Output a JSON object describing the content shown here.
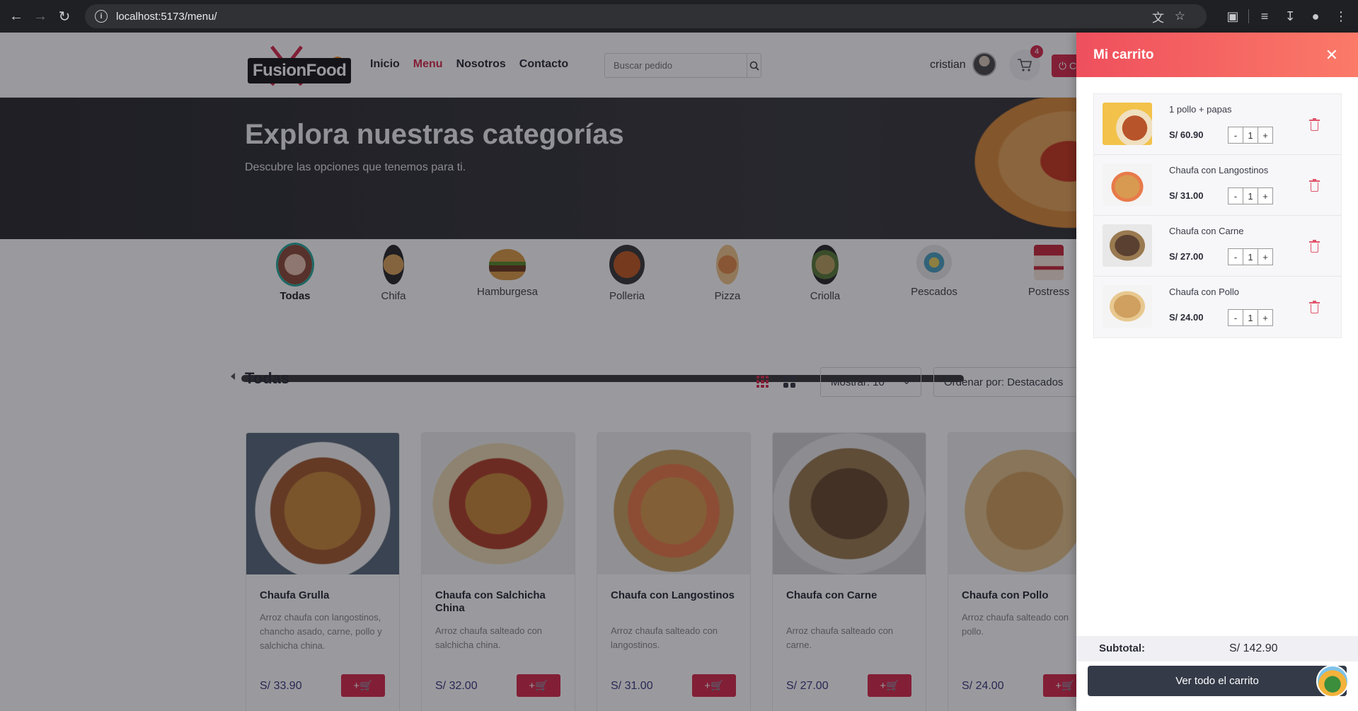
{
  "browser": {
    "url": "localhost:5173/menu/"
  },
  "header": {
    "logo_text": "FusionFood",
    "nav": [
      {
        "label": "Inicio",
        "active": false
      },
      {
        "label": "Menu",
        "active": true
      },
      {
        "label": "Nosotros",
        "active": false
      },
      {
        "label": "Contacto",
        "active": false
      }
    ],
    "search_placeholder": "Buscar pedido",
    "user_name": "cristian",
    "cart_count": "4",
    "logout_label": "C"
  },
  "hero": {
    "title": "Explora nuestras categorías",
    "subtitle": "Descubre las opciones que tenemos para ti."
  },
  "categories": [
    {
      "label": "Todas",
      "active": true
    },
    {
      "label": "Chifa",
      "active": false
    },
    {
      "label": "Hamburgesa",
      "active": false
    },
    {
      "label": "Polleria",
      "active": false
    },
    {
      "label": "Pizza",
      "active": false
    },
    {
      "label": "Criolla",
      "active": false
    },
    {
      "label": "Pescados",
      "active": false
    },
    {
      "label": "Postress",
      "active": false
    }
  ],
  "listing": {
    "title": "Todas",
    "show_label": "Mostrar: 10",
    "sort_label": "Ordenar por: Destacados"
  },
  "products": [
    {
      "name": "Chaufa Grulla",
      "desc": "Arroz chaufa con langostinos, chancho asado, carne, pollo y salchicha china.",
      "price": "S/ 33.90"
    },
    {
      "name": "Chaufa con Salchicha China",
      "desc": "Arroz chaufa salteado con salchicha china.",
      "price": "S/ 32.00"
    },
    {
      "name": "Chaufa con Langostinos",
      "desc": "Arroz chaufa salteado con langostinos.",
      "price": "S/ 31.00"
    },
    {
      "name": "Chaufa con Carne",
      "desc": "Arroz chaufa salteado con carne.",
      "price": "S/ 27.00"
    },
    {
      "name": "Chaufa con Pollo",
      "desc": "Arroz chaufa salteado con pollo.",
      "price": "S/ 24.00"
    }
  ],
  "cart": {
    "title": "Mi carrito",
    "items": [
      {
        "name": "1 pollo + papas",
        "price": "S/ 60.90",
        "qty": "1"
      },
      {
        "name": "Chaufa con Langostinos",
        "price": "S/ 31.00",
        "qty": "1"
      },
      {
        "name": "Chaufa con Carne",
        "price": "S/ 27.00",
        "qty": "1"
      },
      {
        "name": "Chaufa con Pollo",
        "price": "S/ 24.00",
        "qty": "1"
      }
    ],
    "subtotal_label": "Subtotal:",
    "subtotal_value": "S/ 142.90",
    "view_cart_label": "Ver todo el carrito"
  },
  "colors": {
    "accent": "#d62b4d",
    "drawer_header": "#f25f62",
    "dark_button": "#343a48"
  }
}
